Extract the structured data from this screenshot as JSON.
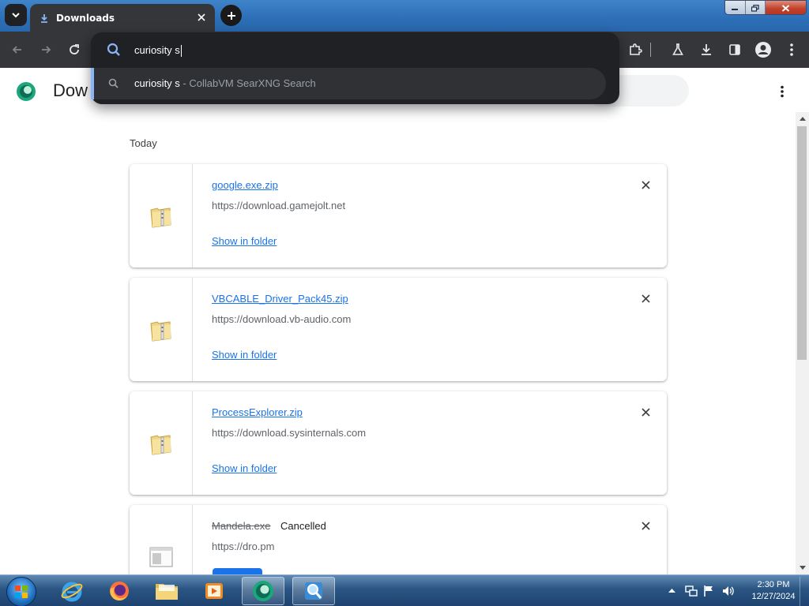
{
  "browser": {
    "tab_title": "Downloads",
    "new_tab_label": "+",
    "tab_icon": "download-icon"
  },
  "omnibox": {
    "query": "curiosity s",
    "suggestion": {
      "text": "curiosity s",
      "separator": " - ",
      "description": "CollabVM SearXNG Search",
      "icon": "search-icon"
    }
  },
  "page": {
    "title": "Dow",
    "date_heading": "Today"
  },
  "downloads": [
    {
      "name": "google.exe.zip",
      "url": "https://download.gamejolt.net",
      "action": "Show in folder",
      "icon": "zip-folder-icon"
    },
    {
      "name": "VBCABLE_Driver_Pack45.zip",
      "url": "https://download.vb-audio.com",
      "action": "Show in folder",
      "icon": "zip-folder-icon"
    },
    {
      "name": "ProcessExplorer.zip",
      "url": "https://download.sysinternals.com",
      "action": "Show in folder",
      "icon": "zip-folder-icon"
    },
    {
      "name": "Mandela.exe",
      "status": "Cancelled",
      "url": "https://dro.pm",
      "icon": "exe-file-icon"
    }
  ],
  "taskbar": {
    "apps": [
      "internet-explorer",
      "firefox",
      "file-explorer",
      "media-player",
      "browser",
      "magnifier"
    ],
    "time": "2:30 PM",
    "date": "12/27/2024"
  },
  "colors": {
    "link": "#1a73e8",
    "toolbar": "#35363a",
    "omnibox": "#202124",
    "suggestion_bg": "#303134"
  }
}
